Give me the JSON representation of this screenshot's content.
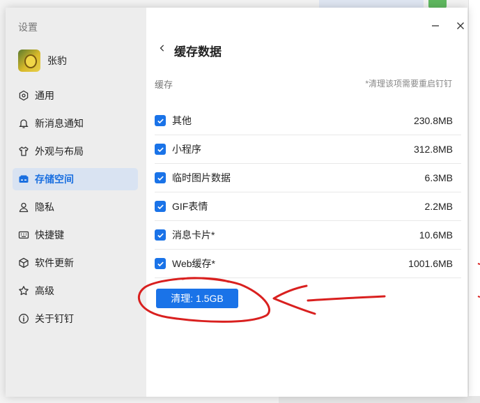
{
  "sidebar": {
    "title": "设置",
    "profile_name": "张豹",
    "items": [
      {
        "label": "通用",
        "icon": "gear-icon",
        "active": false
      },
      {
        "label": "新消息通知",
        "icon": "bell-icon",
        "active": false
      },
      {
        "label": "外观与布局",
        "icon": "shirt-icon",
        "active": false
      },
      {
        "label": "存储空间",
        "icon": "storage-icon",
        "active": true
      },
      {
        "label": "隐私",
        "icon": "user-icon",
        "active": false
      },
      {
        "label": "快捷键",
        "icon": "keyboard-icon",
        "active": false
      },
      {
        "label": "软件更新",
        "icon": "cube-icon",
        "active": false
      },
      {
        "label": "高级",
        "icon": "star-icon",
        "active": false
      },
      {
        "label": "关于钉钉",
        "icon": "info-icon",
        "active": false
      }
    ]
  },
  "main": {
    "title": "缓存数据",
    "section_label": "缓存",
    "section_note": "*清理该项需要重启钉钉",
    "rows": [
      {
        "label": "其他",
        "size": "230.8MB",
        "checked": true
      },
      {
        "label": "小程序",
        "size": "312.8MB",
        "checked": true
      },
      {
        "label": "临时图片数据",
        "size": "6.3MB",
        "checked": true
      },
      {
        "label": "GIF表情",
        "size": "2.2MB",
        "checked": true
      },
      {
        "label": "消息卡片*",
        "size": "10.6MB",
        "checked": true
      },
      {
        "label": "Web缓存*",
        "size": "1001.6MB",
        "checked": true
      }
    ],
    "clear_button": "清理: 1.5GB"
  },
  "colors": {
    "accent": "#1a73e8",
    "active_nav_bg": "#d9e3f2",
    "annotation": "#d9201f"
  }
}
